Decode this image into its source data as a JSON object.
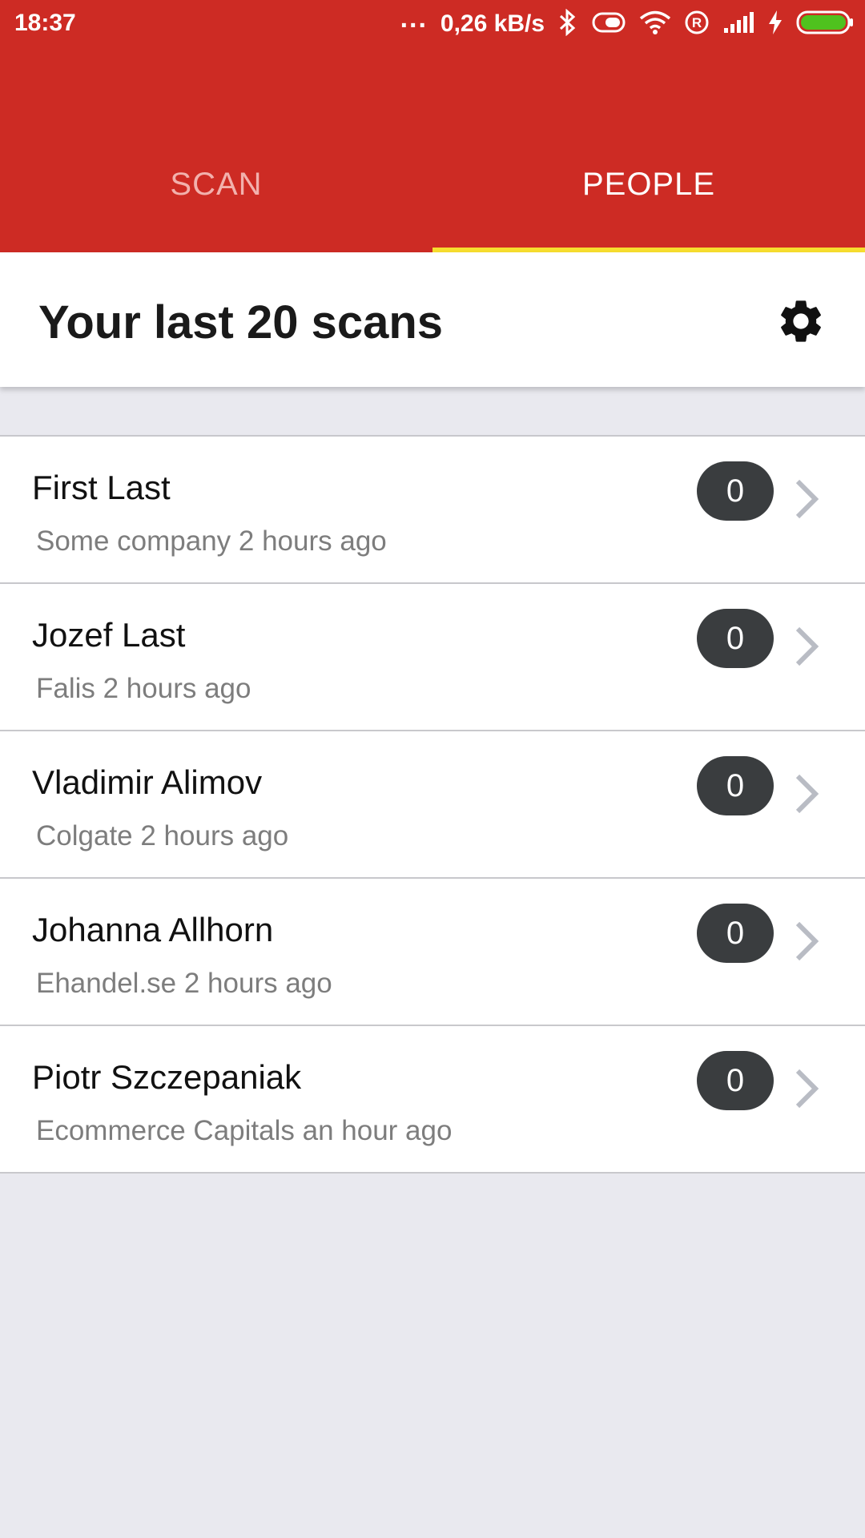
{
  "status_bar": {
    "time": "18:37",
    "dots": "...",
    "network_speed": "0,26 kB/s",
    "icons": [
      "bluetooth-icon",
      "vibrate-icon",
      "wifi-icon",
      "roaming-r-icon",
      "signal-icon",
      "charging-icon",
      "battery-icon"
    ]
  },
  "tabs": [
    {
      "label": "SCAN",
      "active": false
    },
    {
      "label": "PEOPLE",
      "active": true
    }
  ],
  "header": {
    "title": "Your last 20 scans",
    "settings_icon": "gear-icon"
  },
  "people": [
    {
      "name": "First Last",
      "subtitle": "Some company 2 hours ago",
      "count": "0"
    },
    {
      "name": "Jozef Last",
      "subtitle": "Falis 2 hours ago",
      "count": "0"
    },
    {
      "name": "Vladimir Alimov",
      "subtitle": "Colgate 2 hours ago",
      "count": "0"
    },
    {
      "name": "Johanna Allhorn",
      "subtitle": "Ehandel.se 2 hours ago",
      "count": "0"
    },
    {
      "name": "Piotr Szczepaniak",
      "subtitle": "Ecommerce Capitals an hour ago",
      "count": "0"
    }
  ],
  "colors": {
    "app_bar": "#cd2b24",
    "tab_indicator": "#f7dd2e",
    "badge": "#3a3d3f",
    "background": "#e9e9ef"
  }
}
